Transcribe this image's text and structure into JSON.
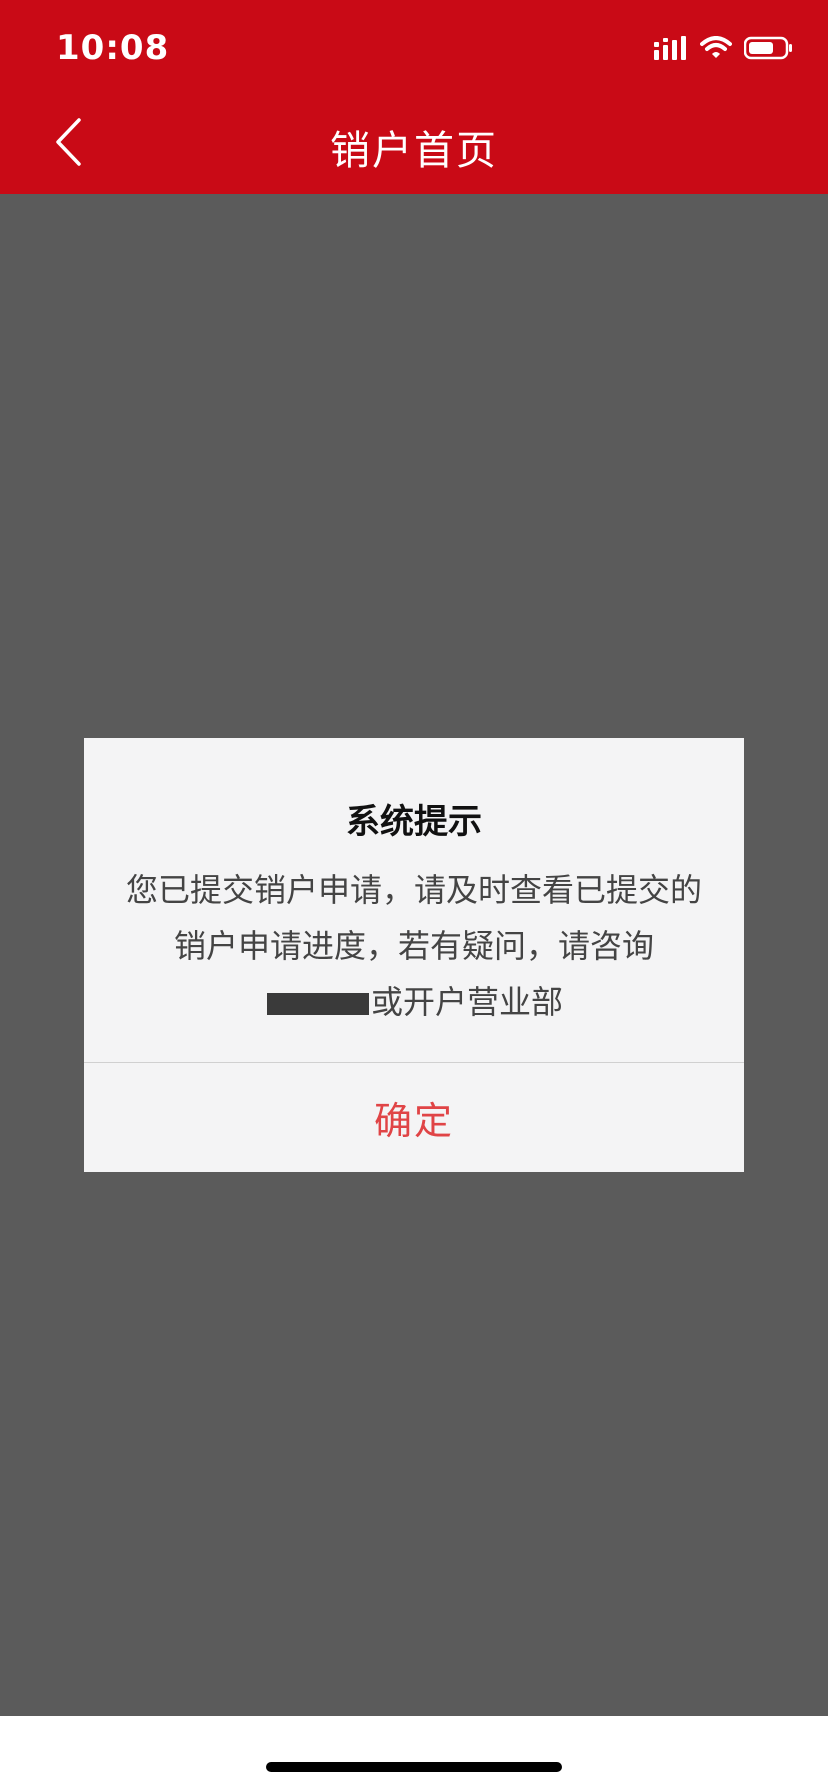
{
  "status_bar": {
    "time": "10:08",
    "icons": [
      "signal-icon",
      "wifi-icon",
      "battery-icon"
    ]
  },
  "nav": {
    "title": "销户首页",
    "back_icon": "chevron-left-icon"
  },
  "dialog": {
    "title": "系统提示",
    "message_part1": "您已提交销户申请，请及时查看已提交的销户申请进度，若有疑问，请咨询",
    "message_part2": "或开户营业部",
    "confirm_label": "确定"
  },
  "colors": {
    "brand_red": "#c90a16",
    "overlay_gray": "#5b5b5b",
    "confirm_red": "#e04446"
  }
}
